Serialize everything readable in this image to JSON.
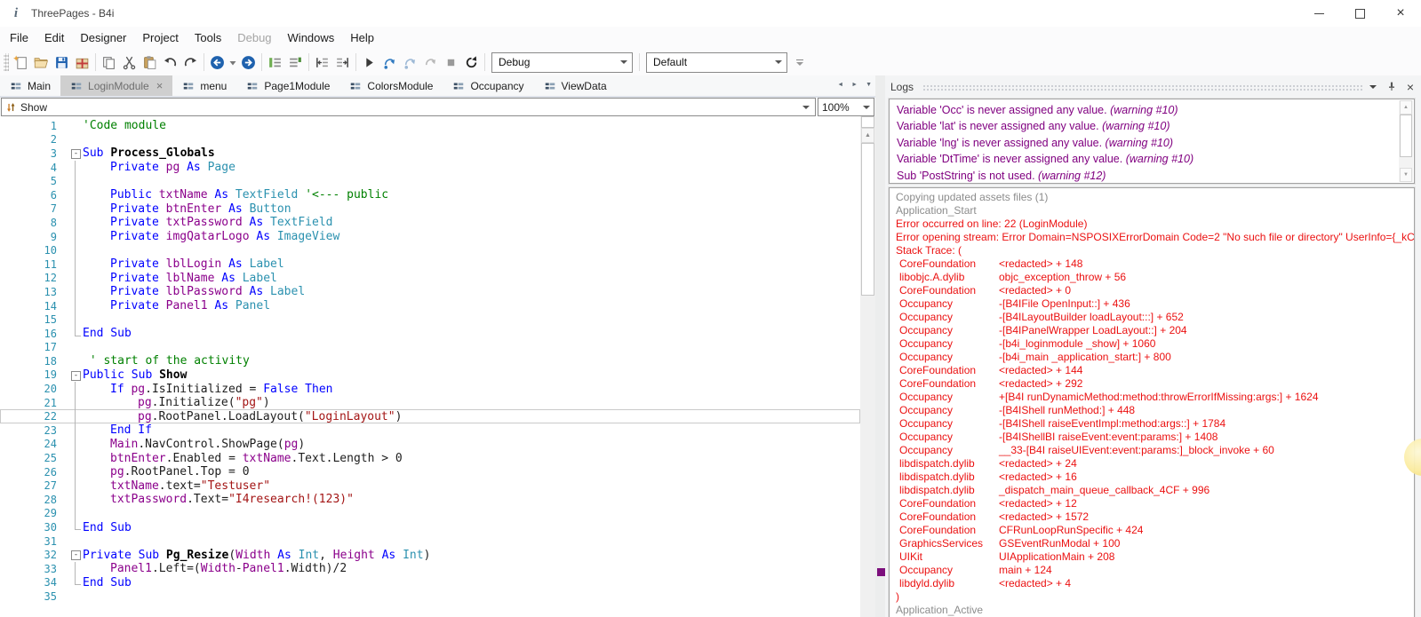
{
  "window": {
    "title": "ThreePages - B4i"
  },
  "menu_bar": {
    "items": [
      {
        "label": "File",
        "enabled": true
      },
      {
        "label": "Edit",
        "enabled": true
      },
      {
        "label": "Designer",
        "enabled": true
      },
      {
        "label": "Project",
        "enabled": true
      },
      {
        "label": "Tools",
        "enabled": true
      },
      {
        "label": "Debug",
        "enabled": false
      },
      {
        "label": "Windows",
        "enabled": true
      },
      {
        "label": "Help",
        "enabled": true
      }
    ]
  },
  "toolbar": {
    "build_config": "Debug",
    "profile": "Default",
    "groups": [
      [
        "new-module",
        "open-project",
        "save",
        "export-package"
      ],
      [
        "copy",
        "cut",
        "paste",
        "undo",
        "redo"
      ],
      [
        "navigate-back",
        "navigate-back-dropdown",
        "navigate-forward"
      ],
      [
        "format-code",
        "comment-code"
      ],
      [
        "shift-left",
        "shift-right"
      ],
      [
        "run",
        "step-into",
        "step-over",
        "step-out",
        "stop",
        "restart"
      ]
    ]
  },
  "tab_bar": {
    "tabs": [
      {
        "label": "Main"
      },
      {
        "label": "LoginModule",
        "active": true,
        "closable": true
      },
      {
        "label": "menu"
      },
      {
        "label": "Page1Module"
      },
      {
        "label": "ColorsModule"
      },
      {
        "label": "Occupancy"
      },
      {
        "label": "ViewData"
      }
    ]
  },
  "editor": {
    "module_selector": "Show",
    "zoom_level": "100%",
    "lines": [
      {
        "n": 1,
        "fold": "",
        "indent": 0,
        "tokens": [
          [
            "cmt",
            "'Code module"
          ]
        ]
      },
      {
        "n": 2
      },
      {
        "n": 3,
        "fold": "box",
        "tokens": [
          [
            "kw",
            "Sub "
          ],
          [
            "sub",
            "Process_Globals"
          ]
        ]
      },
      {
        "n": 4,
        "fold": "line",
        "indent": 1,
        "tokens": [
          [
            "kw",
            "Private "
          ],
          [
            "var",
            "pg "
          ],
          [
            "kw",
            "As "
          ],
          [
            "type",
            "Page"
          ]
        ]
      },
      {
        "n": 5,
        "fold": "line"
      },
      {
        "n": 6,
        "fold": "line",
        "indent": 1,
        "tokens": [
          [
            "kw",
            "Public "
          ],
          [
            "var",
            "txtName "
          ],
          [
            "kw",
            "As "
          ],
          [
            "type",
            "TextField "
          ],
          [
            "cmt",
            "'<--- public"
          ]
        ]
      },
      {
        "n": 7,
        "fold": "line",
        "indent": 1,
        "tokens": [
          [
            "kw",
            "Private "
          ],
          [
            "var",
            "btnEnter "
          ],
          [
            "kw",
            "As "
          ],
          [
            "type",
            "Button"
          ]
        ]
      },
      {
        "n": 8,
        "fold": "line",
        "indent": 1,
        "tokens": [
          [
            "kw",
            "Private "
          ],
          [
            "var",
            "txtPassword "
          ],
          [
            "kw",
            "As "
          ],
          [
            "type",
            "TextField"
          ]
        ]
      },
      {
        "n": 9,
        "fold": "line",
        "indent": 1,
        "tokens": [
          [
            "kw",
            "Private "
          ],
          [
            "var",
            "imgQatarLogo "
          ],
          [
            "kw",
            "As "
          ],
          [
            "type",
            "ImageView"
          ]
        ]
      },
      {
        "n": 10,
        "fold": "line"
      },
      {
        "n": 11,
        "fold": "line",
        "indent": 1,
        "tokens": [
          [
            "kw",
            "Private "
          ],
          [
            "var",
            "lblLogin "
          ],
          [
            "kw",
            "As "
          ],
          [
            "type",
            "Label"
          ]
        ]
      },
      {
        "n": 12,
        "fold": "line",
        "indent": 1,
        "tokens": [
          [
            "kw",
            "Private "
          ],
          [
            "var",
            "lblName "
          ],
          [
            "kw",
            "As "
          ],
          [
            "type",
            "Label"
          ]
        ]
      },
      {
        "n": 13,
        "fold": "line",
        "indent": 1,
        "tokens": [
          [
            "kw",
            "Private "
          ],
          [
            "var",
            "lblPassword "
          ],
          [
            "kw",
            "As "
          ],
          [
            "type",
            "Label"
          ]
        ]
      },
      {
        "n": 14,
        "fold": "line",
        "indent": 1,
        "tokens": [
          [
            "kw",
            "Private "
          ],
          [
            "var",
            "Panel1 "
          ],
          [
            "kw",
            "As "
          ],
          [
            "type",
            "Panel"
          ]
        ]
      },
      {
        "n": 15,
        "fold": "line"
      },
      {
        "n": 16,
        "fold": "end",
        "tokens": [
          [
            "kw",
            "End Sub"
          ]
        ]
      },
      {
        "n": 17
      },
      {
        "n": 18,
        "tokens": [
          [
            "cmt",
            " ' start of the activity"
          ]
        ]
      },
      {
        "n": 19,
        "fold": "box",
        "tokens": [
          [
            "kw",
            "Public Sub "
          ],
          [
            "sub",
            "Show"
          ]
        ]
      },
      {
        "n": 20,
        "fold": "line",
        "indent": 1,
        "tokens": [
          [
            "kw",
            "If "
          ],
          [
            "var",
            "pg"
          ],
          [
            "plain",
            ".IsInitialized = "
          ],
          [
            "kw",
            "False "
          ],
          [
            "kw",
            "Then"
          ]
        ]
      },
      {
        "n": 21,
        "fold": "line",
        "indent": 2,
        "tokens": [
          [
            "var",
            "pg"
          ],
          [
            "plain",
            ".Initialize("
          ],
          [
            "str",
            "\"pg\""
          ],
          [
            "plain",
            ")"
          ]
        ]
      },
      {
        "n": 22,
        "fold": "line",
        "indent": 2,
        "highlight": true,
        "tokens": [
          [
            "var",
            "pg"
          ],
          [
            "plain",
            ".RootPanel.LoadLayout("
          ],
          [
            "str",
            "\"LoginLayout\""
          ],
          [
            "plain",
            ")"
          ]
        ]
      },
      {
        "n": 23,
        "fold": "line",
        "indent": 1,
        "tokens": [
          [
            "kw",
            "End If"
          ]
        ]
      },
      {
        "n": 24,
        "fold": "line",
        "indent": 1,
        "tokens": [
          [
            "var",
            "Main"
          ],
          [
            "plain",
            ".NavControl.ShowPage("
          ],
          [
            "var",
            "pg"
          ],
          [
            "plain",
            ")"
          ]
        ]
      },
      {
        "n": 25,
        "fold": "line",
        "indent": 1,
        "tokens": [
          [
            "var",
            "btnEnter"
          ],
          [
            "plain",
            ".Enabled = "
          ],
          [
            "var",
            "txtName"
          ],
          [
            "plain",
            ".Text.Length > 0"
          ]
        ]
      },
      {
        "n": 26,
        "fold": "line",
        "indent": 1,
        "tokens": [
          [
            "var",
            "pg"
          ],
          [
            "plain",
            ".RootPanel.Top = 0"
          ]
        ]
      },
      {
        "n": 27,
        "fold": "line",
        "indent": 1,
        "tokens": [
          [
            "var",
            "txtName"
          ],
          [
            "plain",
            ".text="
          ],
          [
            "str",
            "\"Testuser\""
          ]
        ]
      },
      {
        "n": 28,
        "fold": "line",
        "indent": 1,
        "tokens": [
          [
            "var",
            "txtPassword"
          ],
          [
            "plain",
            ".Text="
          ],
          [
            "str",
            "\"I4research!(123)\""
          ]
        ]
      },
      {
        "n": 29,
        "fold": "line"
      },
      {
        "n": 30,
        "fold": "end",
        "tokens": [
          [
            "kw",
            "End Sub"
          ]
        ]
      },
      {
        "n": 31
      },
      {
        "n": 32,
        "fold": "box",
        "tokens": [
          [
            "kw",
            "Private Sub "
          ],
          [
            "sub",
            "Pg_Resize"
          ],
          [
            "plain",
            "("
          ],
          [
            "var",
            "Width "
          ],
          [
            "kw",
            "As "
          ],
          [
            "type",
            "Int"
          ],
          [
            "plain",
            ", "
          ],
          [
            "var",
            "Height "
          ],
          [
            "kw",
            "As "
          ],
          [
            "type",
            "Int"
          ],
          [
            "plain",
            ")"
          ]
        ]
      },
      {
        "n": 33,
        "fold": "line",
        "indent": 1,
        "tokens": [
          [
            "var",
            "Panel1"
          ],
          [
            "plain",
            ".Left=("
          ],
          [
            "var",
            "Width"
          ],
          [
            "plain",
            "-"
          ],
          [
            "var",
            "Panel1"
          ],
          [
            "plain",
            ".Width)/2"
          ]
        ]
      },
      {
        "n": 34,
        "fold": "end",
        "tokens": [
          [
            "kw",
            "End Sub"
          ]
        ]
      },
      {
        "n": 35
      }
    ]
  },
  "logs": {
    "title": "Logs",
    "warnings": [
      {
        "text": "Variable 'Occ' is never assigned any value. ",
        "note": "(warning #10)"
      },
      {
        "text": "Variable 'lat' is never assigned any value. ",
        "note": "(warning #10)"
      },
      {
        "text": "Variable 'lng' is never assigned any value. ",
        "note": "(warning #10)"
      },
      {
        "text": "Variable 'DtTime' is never assigned any value. ",
        "note": "(warning #10)"
      },
      {
        "text": "Sub 'PostString' is not used. ",
        "note": "(warning #12)"
      }
    ],
    "lines": [
      {
        "style": "info",
        "text": "Copying updated assets files (1)"
      },
      {
        "style": "info",
        "text": "Application_Start"
      },
      {
        "style": "error",
        "text": "Error occurred on line: 22 (LoginModule)"
      },
      {
        "style": "error",
        "text": "Error opening stream: Error Domain=NSPOSIXErrorDomain Code=2 \"No such file or directory\" UserInfo={_kC"
      },
      {
        "style": "error",
        "text": "Stack Trace: ("
      },
      {
        "style": "error",
        "module": "CoreFoundation",
        "symbol": "<redacted> + 148"
      },
      {
        "style": "error",
        "module": "libobjc.A.dylib",
        "symbol": "objc_exception_throw + 56"
      },
      {
        "style": "error",
        "module": "CoreFoundation",
        "symbol": "<redacted> + 0"
      },
      {
        "style": "error",
        "module": "Occupancy",
        "symbol": "-[B4IFile OpenInput::] + 436"
      },
      {
        "style": "error",
        "module": "Occupancy",
        "symbol": "-[B4ILayoutBuilder loadLayout:::] + 652"
      },
      {
        "style": "error",
        "module": "Occupancy",
        "symbol": "-[B4IPanelWrapper LoadLayout::] + 204"
      },
      {
        "style": "error",
        "module": "Occupancy",
        "symbol": "-[b4i_loginmodule _show] + 1060"
      },
      {
        "style": "error",
        "module": "Occupancy",
        "symbol": "-[b4i_main _application_start:] + 800"
      },
      {
        "style": "error",
        "module": "CoreFoundation",
        "symbol": "<redacted> + 144"
      },
      {
        "style": "error",
        "module": "CoreFoundation",
        "symbol": "<redacted> + 292"
      },
      {
        "style": "error",
        "module": "Occupancy",
        "symbol": "+[B4I runDynamicMethod:method:throwErrorIfMissing:args:] + 1624"
      },
      {
        "style": "error",
        "module": "Occupancy",
        "symbol": "-[B4IShell runMethod:] + 448"
      },
      {
        "style": "error",
        "module": "Occupancy",
        "symbol": "-[B4IShell raiseEventImpl:method:args::] + 1784"
      },
      {
        "style": "error",
        "module": "Occupancy",
        "symbol": "-[B4IShellBI raiseEvent:event:params:] + 1408"
      },
      {
        "style": "error",
        "module": "Occupancy",
        "symbol": "__33-[B4I raiseUIEvent:event:params:]_block_invoke + 60"
      },
      {
        "style": "error",
        "module": "libdispatch.dylib",
        "symbol": "<redacted> + 24"
      },
      {
        "style": "error",
        "module": "libdispatch.dylib",
        "symbol": "<redacted> + 16"
      },
      {
        "style": "error",
        "module": "libdispatch.dylib",
        "symbol": "_dispatch_main_queue_callback_4CF + 996"
      },
      {
        "style": "error",
        "module": "CoreFoundation",
        "symbol": "<redacted> + 12"
      },
      {
        "style": "error",
        "module": "CoreFoundation",
        "symbol": "<redacted> + 1572"
      },
      {
        "style": "error",
        "module": "CoreFoundation",
        "symbol": "CFRunLoopRunSpecific + 424"
      },
      {
        "style": "error",
        "module": "GraphicsServices",
        "symbol": "GSEventRunModal + 100"
      },
      {
        "style": "error",
        "module": "UIKit",
        "symbol": "UIApplicationMain + 208"
      },
      {
        "style": "error",
        "module": "Occupancy",
        "symbol": "main + 124"
      },
      {
        "style": "error",
        "module": "libdyld.dylib",
        "symbol": "<redacted> + 4"
      },
      {
        "style": "error",
        "text": ")"
      },
      {
        "style": "info",
        "text": "Application_Active"
      }
    ]
  }
}
